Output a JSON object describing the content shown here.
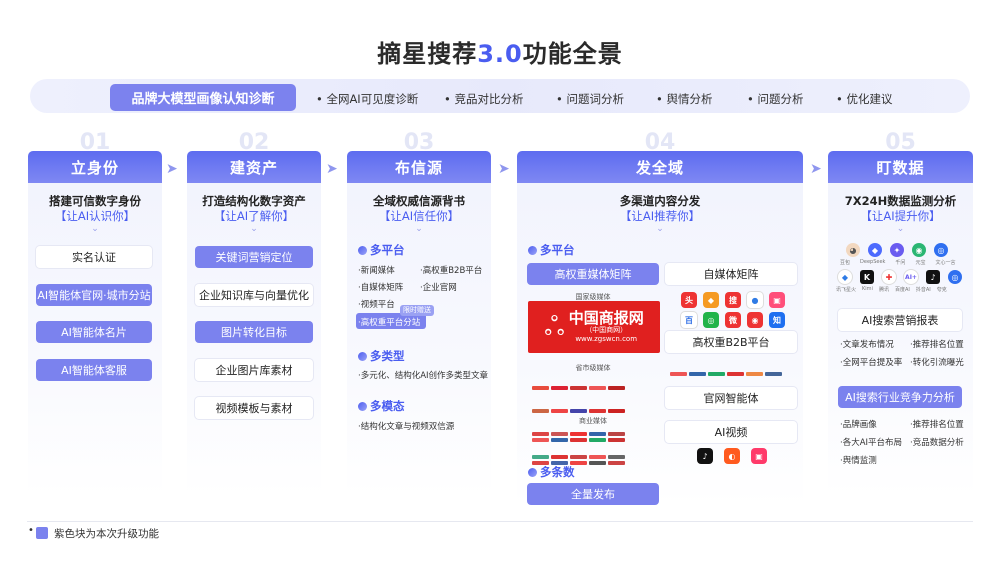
{
  "title": {
    "part1": "摘星搜荐",
    "part2": "3.0",
    "part3": "功能全景"
  },
  "banner": {
    "main": "品牌大模型画像认知诊断",
    "items": [
      "• 全网AI可见度诊断",
      "• 竞品对比分析",
      "• 问题词分析",
      "• 舆情分析",
      "• 问题分析",
      "• 优化建议"
    ]
  },
  "columns": [
    {
      "num": "01",
      "head": "立身份",
      "subtitle": "搭建可信数字身份",
      "tag": "【让AI认识你】",
      "pills": [
        "实名认证",
        "AI智能体官网·城市分站",
        "AI智能体名片",
        "AI智能体客服"
      ]
    },
    {
      "num": "02",
      "head": "建资产",
      "subtitle": "打造结构化数字资产",
      "tag": "【让AI了解你】",
      "pills": [
        "关键词营销定位",
        "企业知识库与向量优化",
        "图片转化目标",
        "企业图片库素材",
        "视频模板与素材"
      ]
    },
    {
      "num": "03",
      "head": "布信源",
      "subtitle": "全域权威信源背书",
      "tag": "【让AI信任你】",
      "sections": [
        {
          "title": "多平台",
          "items": [
            "·新闻媒体",
            "·高权重B2B平台",
            "·自媒体矩阵",
            "·企业官网",
            "·视频平台",
            "·高权重平台分站"
          ],
          "badge": "限时赠送"
        },
        {
          "title": "多类型",
          "items": [
            "·多元化、结构化AI创作多类型文章"
          ]
        },
        {
          "title": "多模态",
          "items": [
            "·结构化文章与视频双信源"
          ]
        }
      ]
    },
    {
      "num": "04",
      "head": "发全域",
      "subtitle": "多渠道内容分发",
      "tag": "【让AI推荐你】",
      "sec1": "多平台",
      "left": {
        "top": "高权重媒体矩阵",
        "national": "国家级媒体",
        "logo_main": "中国商报网",
        "logo_paren": "（中国商网）",
        "logo_url": "www.zgswcn.com",
        "provincial": "省市级媒体",
        "industry": "商业媒体"
      },
      "right": [
        "自媒体矩阵",
        "高权重B2B平台",
        "官网智能体",
        "AI视频"
      ],
      "sec2": "多条数",
      "bottom": "全量发布"
    },
    {
      "num": "05",
      "head": "盯数据",
      "subtitle": "7X24H数据监测分析",
      "tag": "【让AI提升你】",
      "ai_logos": [
        "豆包",
        "DeepSeek",
        "千问",
        "元宝",
        "文心一言",
        "讯飞星火",
        "Kimi",
        "腾讯",
        "百度AI",
        "抖音AI",
        "夸克"
      ],
      "report1": "AI搜索营销报表",
      "report1_items": [
        "·文章发布情况",
        "·推荐排名位置",
        "·全网平台提及率",
        "·转化引流曝光"
      ],
      "report2": "AI搜索行业竞争力分析",
      "report2_items": [
        "·品牌画像",
        "·推荐排名位置",
        "·各大AI平台布局",
        "·竞品数据分析",
        "·舆情监测"
      ]
    }
  ],
  "legend": "紫色块为本次升级功能",
  "colors": {
    "accent": "#4a5df0",
    "purple_block": "#7b82ee",
    "logo_red": "#e0201f"
  }
}
